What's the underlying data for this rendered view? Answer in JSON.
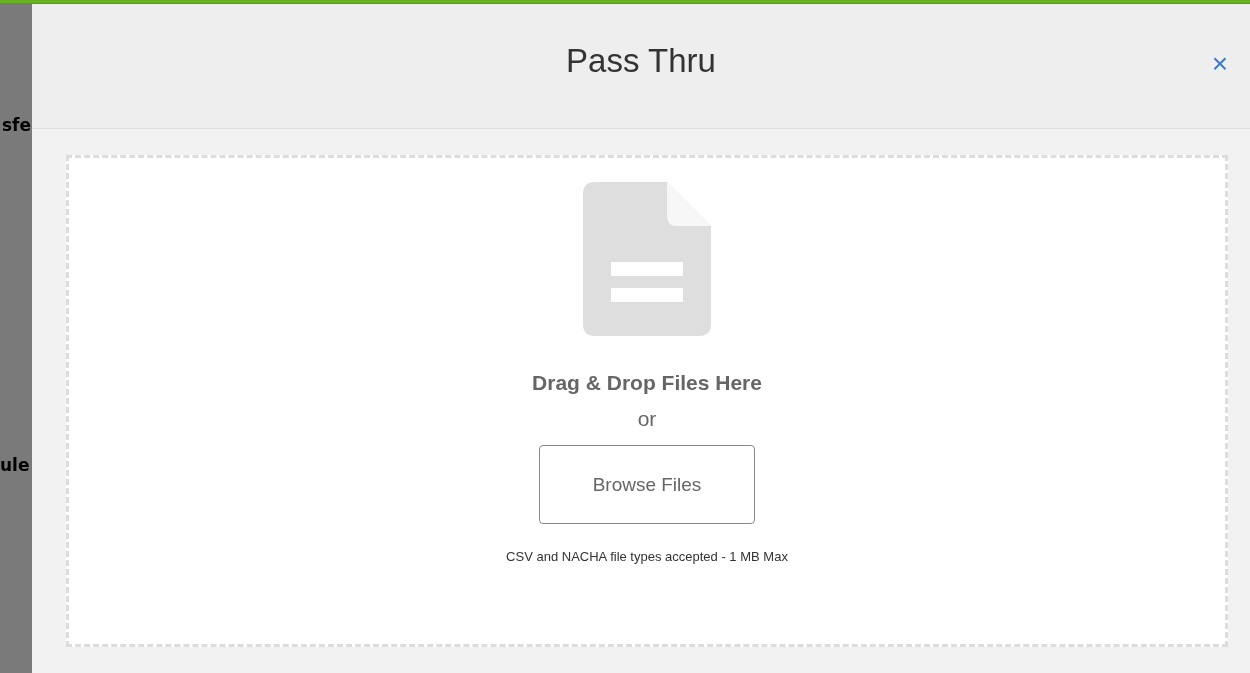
{
  "background_page": {
    "texts": [
      {
        "text": "sfe",
        "kind": "link"
      },
      {
        "text": "ule",
        "kind": "heading"
      }
    ]
  },
  "modal": {
    "title": "Pass Thru",
    "close": "×",
    "dropzone": {
      "heading": "Drag & Drop Files Here",
      "separator": "or",
      "button": "Browse Files",
      "note": "CSV and NACHA file types accepted - 1 MB Max"
    }
  }
}
